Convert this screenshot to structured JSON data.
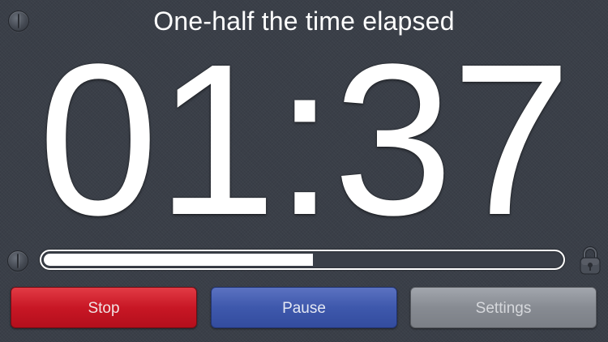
{
  "status": {
    "message": "One-half the time elapsed"
  },
  "timer": {
    "display": "01:37"
  },
  "progress": {
    "fraction": 0.52
  },
  "controls": {
    "stop_label": "Stop",
    "pause_label": "Pause",
    "settings_label": "Settings"
  },
  "icons": {
    "top_left": "dimmer-icon",
    "bottom_left": "dimmer-icon",
    "lock": "lock-icon"
  },
  "colors": {
    "background": "#3a3f48",
    "stop": "#c81725",
    "pause": "#3e58ac",
    "settings": "#878b92",
    "text": "#ffffff"
  }
}
